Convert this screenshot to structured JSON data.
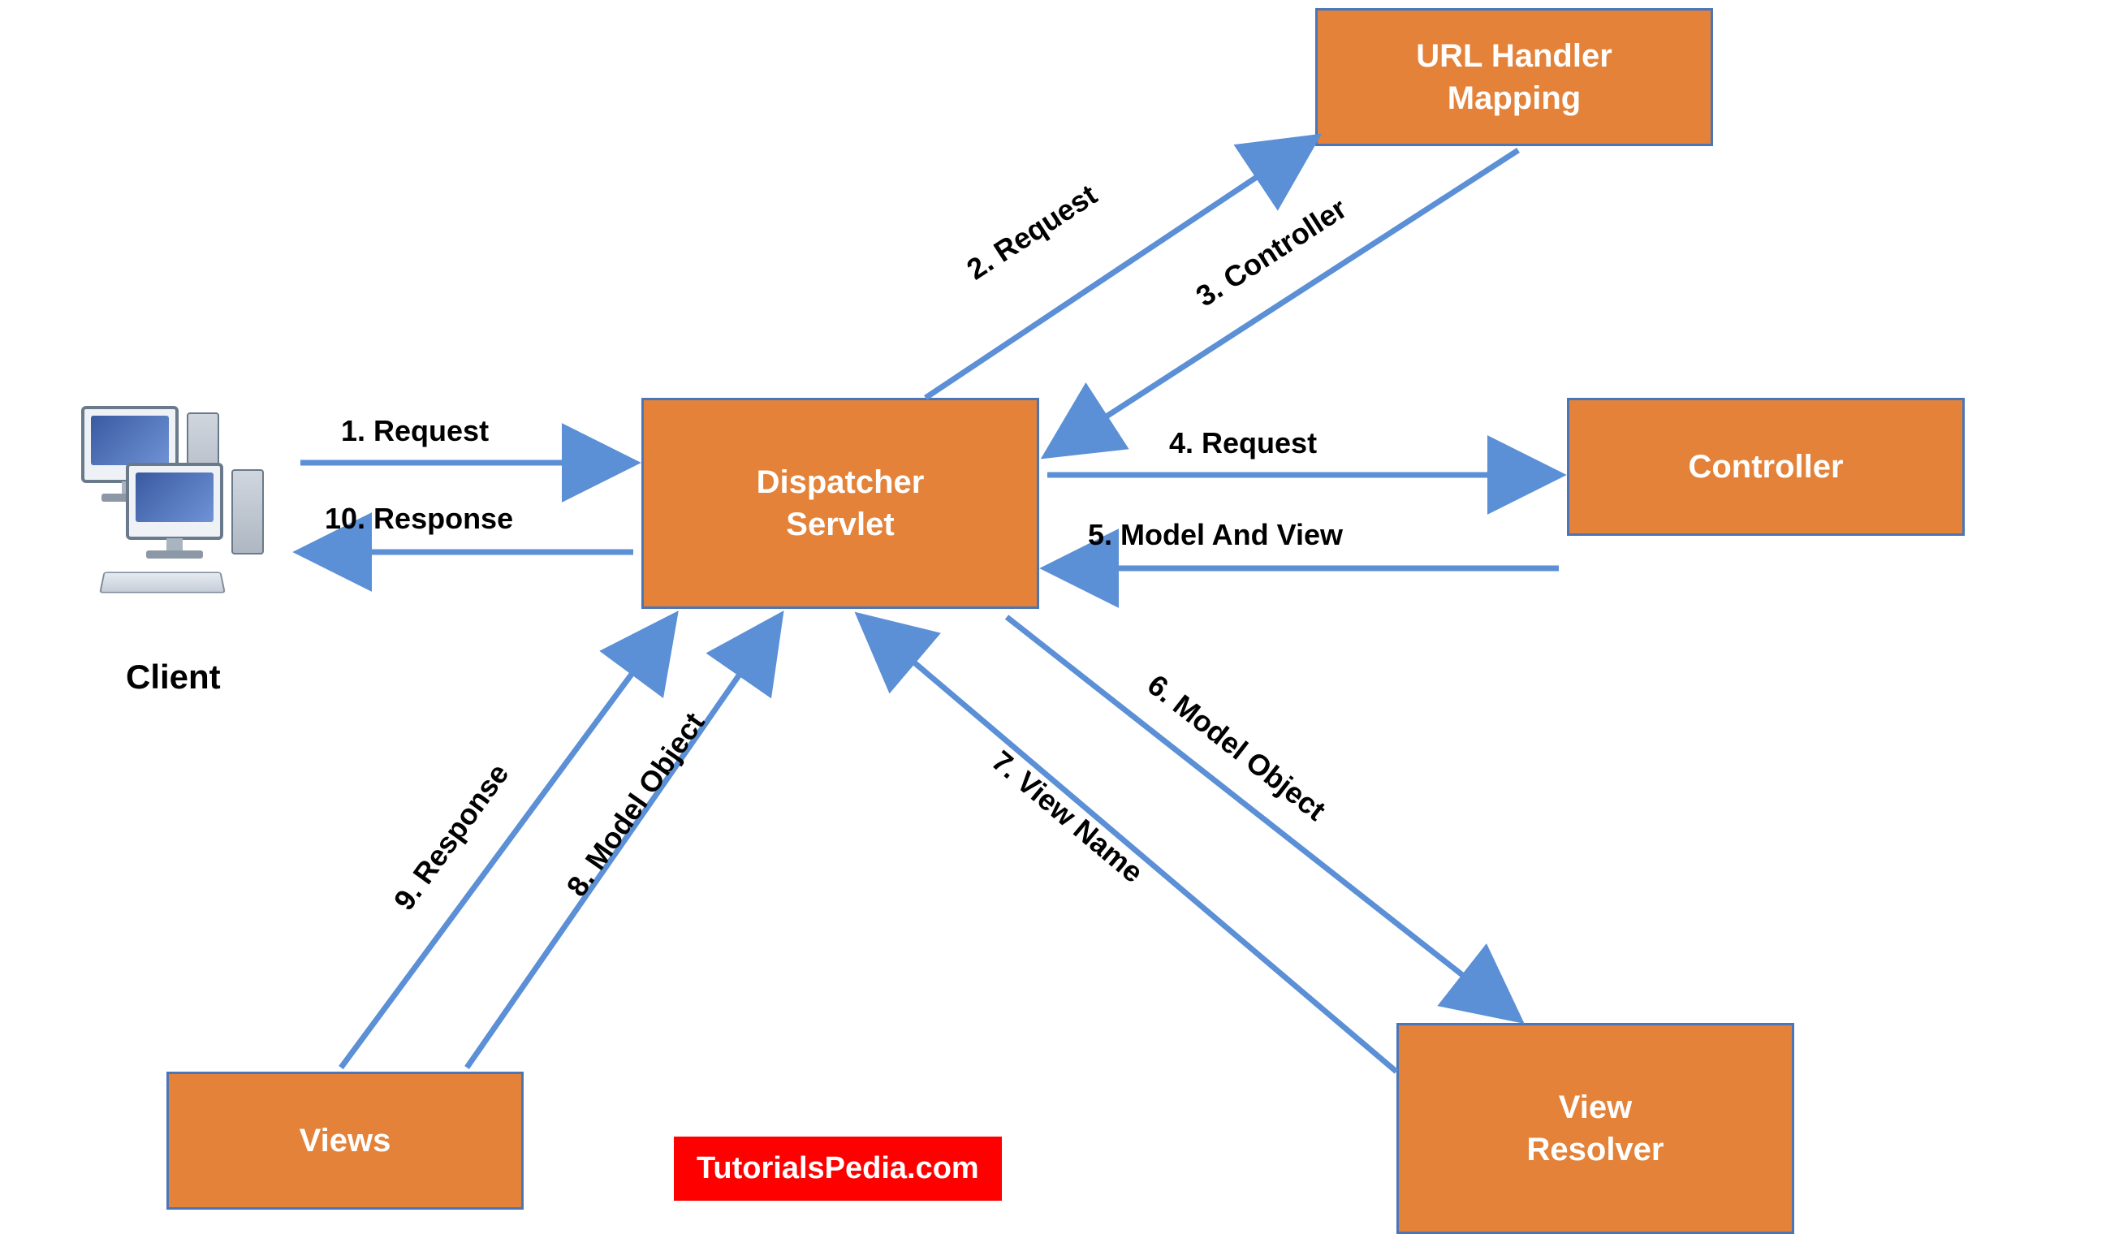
{
  "nodes": {
    "client": {
      "label": "Client"
    },
    "dispatcher": {
      "line1": "Dispatcher",
      "line2": "Servlet"
    },
    "url_handler": {
      "line1": "URL Handler",
      "line2": "Mapping"
    },
    "controller": {
      "line1": "Controller"
    },
    "views": {
      "line1": "Views"
    },
    "view_resolver": {
      "line1": "View",
      "line2": "Resolver"
    }
  },
  "edges": {
    "e1": "1. Request",
    "e2": "2. Request",
    "e3": "3. Controller",
    "e4": "4. Request",
    "e5": "5. Model And View",
    "e6": "6. Model Object",
    "e7": "7. View Name",
    "e8": "8. Model Object",
    "e9": "9. Response",
    "e10": "10. Response"
  },
  "credit": "TutorialsPedia.com",
  "colors": {
    "box_fill": "#e38238",
    "box_border": "#4a76b8",
    "arrow": "#5b8fd6",
    "credit_bg": "#ff0000"
  }
}
